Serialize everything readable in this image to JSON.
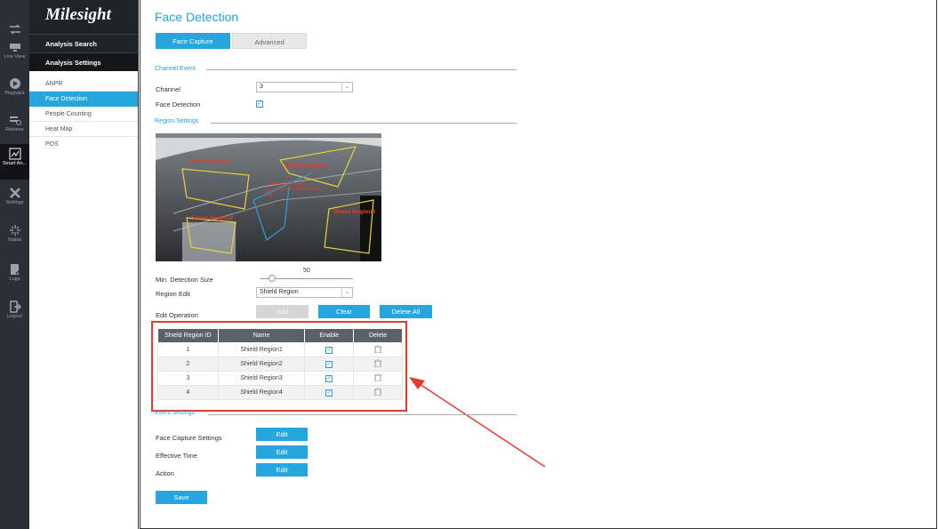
{
  "rail": [
    {
      "label": "",
      "icon": "swap-icon"
    },
    {
      "label": "Live View",
      "icon": "live-view-icon"
    },
    {
      "label": "Playback",
      "icon": "playback-icon"
    },
    {
      "label": "Retrieve",
      "icon": "retrieve-icon"
    },
    {
      "label": "Smart An...",
      "icon": "smart-analysis-icon"
    },
    {
      "label": "Settings",
      "icon": "settings-icon"
    },
    {
      "label": "Status",
      "icon": "status-icon"
    },
    {
      "label": "Logs",
      "icon": "logs-icon"
    },
    {
      "label": "Logout",
      "icon": "logout-icon"
    }
  ],
  "sidebar": {
    "brand": "Milesight",
    "sections": [
      "Analysis Search",
      "Analysis Settings"
    ],
    "items": [
      "ANPR",
      "Face Detection",
      "People Counting",
      "Heat Map",
      "POS"
    ]
  },
  "page": {
    "title": "Face Detection",
    "tabs": [
      "Face Capture",
      "Advanced"
    ]
  },
  "channel_event": {
    "heading": "Channel Event",
    "channel_label": "Channel",
    "channel_value": "3",
    "face_detection_label": "Face Detection"
  },
  "region_settings": {
    "heading": "Region Settings",
    "overlay_labels": [
      "Shield Region1",
      "Shield Region3",
      "Shield Region2",
      "Shield Region4",
      "Minimum Region",
      "Face Snapshot Area"
    ],
    "min_size_label": "Min. Detection Size",
    "min_size_value": "50",
    "min_size_fraction": 0.1,
    "region_edit_label": "Region Edit",
    "region_edit_value": "Shield Region",
    "edit_operation_label": "Edit Operation",
    "buttons": {
      "add": "Add",
      "clear": "Clear",
      "delete_all": "Delete All"
    }
  },
  "table": {
    "headers": [
      "Shield Region ID",
      "Name",
      "Enable",
      "Delete"
    ],
    "rows": [
      {
        "id": "1",
        "name": "Shield Region1"
      },
      {
        "id": "2",
        "name": "Shield Region2"
      },
      {
        "id": "3",
        "name": "Shield Region3"
      },
      {
        "id": "4",
        "name": "Shield Region4"
      }
    ]
  },
  "event_settings": {
    "heading": "Event Settings",
    "rows": [
      "Face Capture Settings",
      "Effective Time",
      "Action"
    ],
    "edit_label": "Edit"
  },
  "save_label": "Save",
  "colors": {
    "accent": "#25a6dc",
    "highlight": "#e53b2e"
  }
}
